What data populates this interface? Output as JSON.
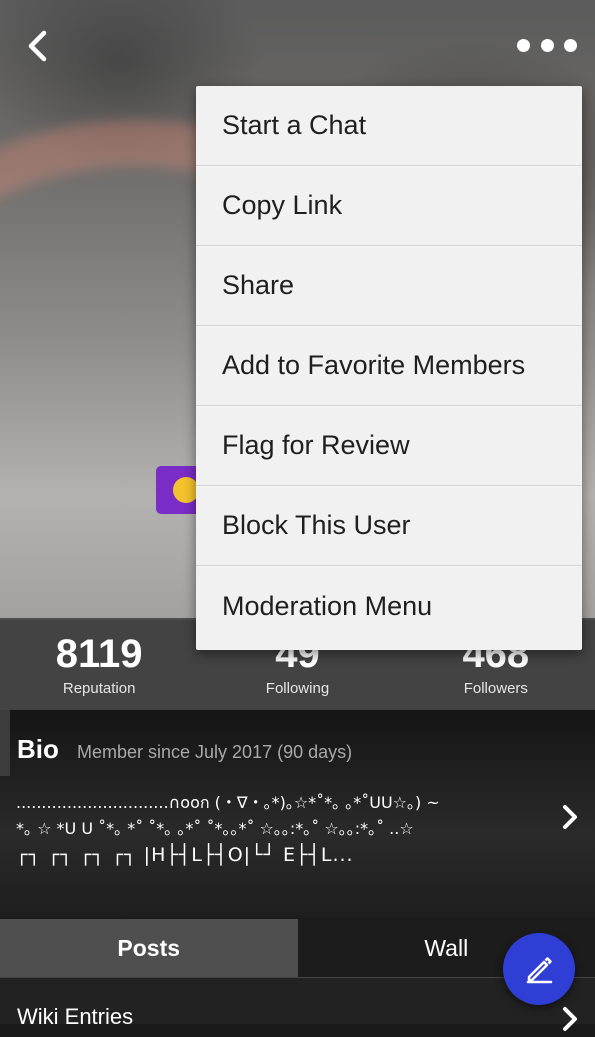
{
  "header": {
    "back_icon": "chevron-left-icon",
    "more_icon": "more-horizontal-icon"
  },
  "menu": {
    "items": [
      "Start a Chat",
      "Copy Link",
      "Share",
      "Add to Favorite Members",
      "Flag for Review",
      "Block This User",
      "Moderation Menu"
    ]
  },
  "stats": {
    "reputation": {
      "value": "8119",
      "label": "Reputation"
    },
    "following": {
      "value": "49",
      "label": "Following"
    },
    "followers": {
      "value": "468",
      "label": "Followers"
    }
  },
  "bio": {
    "title": "Bio",
    "since": "Member since July 2017 (90 days)",
    "line1": "..............................∩ooก (・∇・｡*)｡☆*˚*｡ ｡*˚UU☆｡) ~",
    "line2": "*｡ ☆ *U U ˚*｡ *˚ ˚*｡ ｡*˚ ˚*｡｡*˚ ☆｡｡:*｡˚ ☆｡｡:*｡˚ ..☆",
    "line3": "┌┐ ┌┐ ┌┐ ┌┐ |H├┤L├┤O|└┘ E├┤L..."
  },
  "tabs": {
    "posts": "Posts",
    "wall": "Wall"
  },
  "wiki": {
    "label": "Wiki Entries"
  },
  "colors": {
    "fab": "#2f3fd6",
    "avatar_frame": "#7a2cc7",
    "menu_bg": "#f1f1f1"
  }
}
